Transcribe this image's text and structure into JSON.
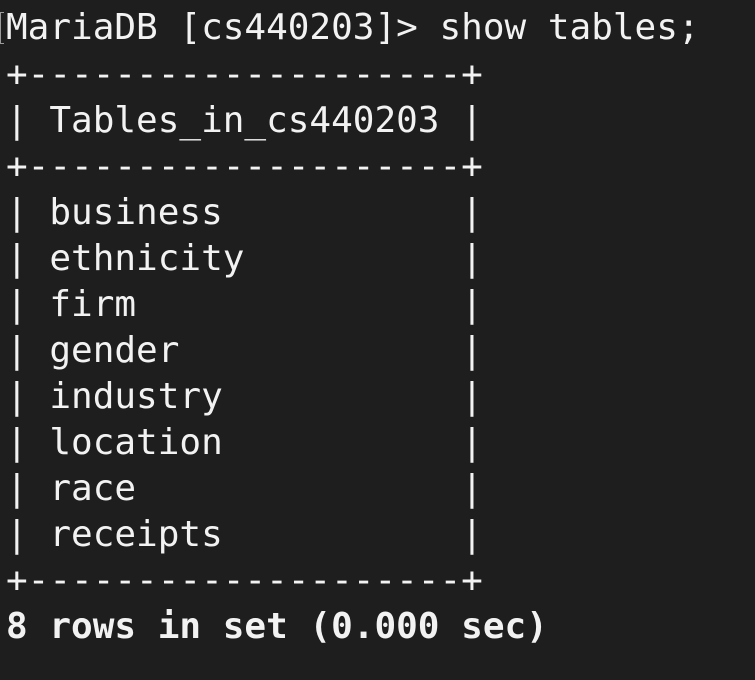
{
  "terminal": {
    "prompt": "MariaDB [cs440203]> ",
    "command": "show tables;",
    "border": "+--------------------+",
    "header_line": "| Tables_in_cs440203 |",
    "rows": [
      "| business           |",
      "| ethnicity          |",
      "| firm               |",
      "| gender             |",
      "| industry           |",
      "| location           |",
      "| race               |",
      "| receipts           |"
    ],
    "status": "8 rows in set (0.000 sec)"
  },
  "colors": {
    "background": "#1e1e1e",
    "text": "#f2f2f2"
  }
}
